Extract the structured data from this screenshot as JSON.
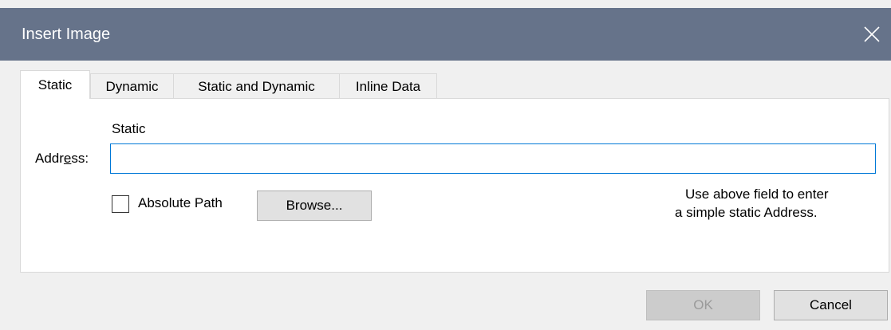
{
  "window": {
    "title": "Insert Image",
    "close_glyph": "✕"
  },
  "tabs": [
    {
      "label": "Static",
      "active": true
    },
    {
      "label": "Dynamic",
      "active": false
    },
    {
      "label": "Static and Dynamic",
      "active": false
    },
    {
      "label": "Inline Data",
      "active": false
    }
  ],
  "static_panel": {
    "section_label": "Static",
    "address_label_pre": "Addr",
    "address_label_mnemonic": "e",
    "address_label_post": "ss:",
    "address_value": "",
    "absolute_path_label": "Absolute Path",
    "absolute_path_checked": false,
    "browse_label": "Browse...",
    "hint_line1": "Use above field to enter",
    "hint_line2": "a simple static Address."
  },
  "footer": {
    "ok_label": "OK",
    "ok_enabled": false,
    "cancel_label": "Cancel"
  },
  "colors": {
    "titlebar": "#66738a",
    "focus_border": "#0078d7",
    "dialog_bg": "#f0f0f0"
  },
  "icons": {
    "close": "close-icon"
  }
}
